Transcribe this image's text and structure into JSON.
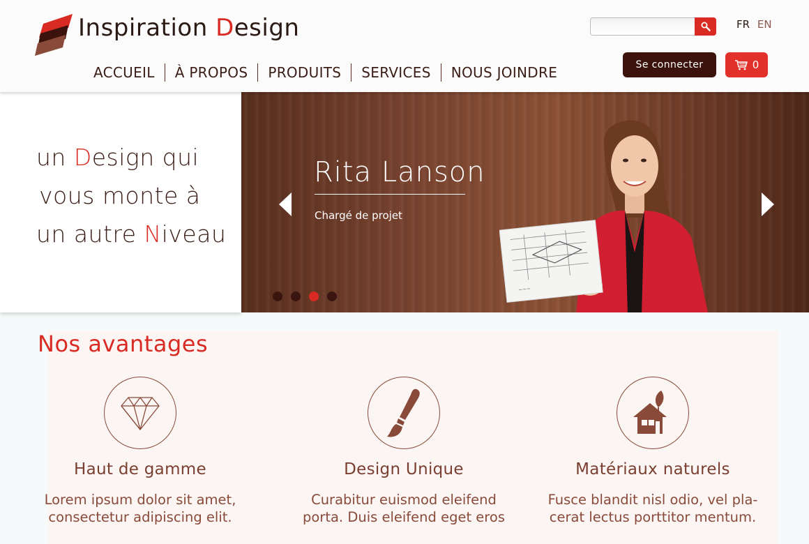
{
  "header": {
    "logo_text_main": "Inspiration ",
    "logo_text_accent": "D",
    "logo_text_rest": "esign",
    "search_placeholder": "",
    "lang_fr": "FR",
    "lang_en": "EN",
    "login_label": "Se connecter",
    "cart_count": "0",
    "nav": [
      "ACCUEIL",
      "À PROPOS",
      "PRODUITS",
      "SERVICES",
      "NOUS JOINDRE"
    ]
  },
  "hero": {
    "tagline": {
      "line1_pre": "un ",
      "line1_accent": "D",
      "line1_post": "esign qui",
      "line2": "vous monte à",
      "line3_pre": "un autre ",
      "line3_accent": "N",
      "line3_post": "iveau"
    },
    "slide": {
      "name": "Rita Lanson",
      "role": "Chargé de projet",
      "active_index": 3,
      "total": 4
    }
  },
  "advantages": {
    "title": "Nos avantages",
    "items": [
      {
        "icon": "diamond-icon",
        "title": "Haut de gamme",
        "text_line1": "Lorem ipsum dolor sit amet,",
        "text_line2": "consectetur adipiscing elit."
      },
      {
        "icon": "paintbrush-icon",
        "title": "Design Unique",
        "text_line1": "Curabitur euismod eleifend",
        "text_line2": "porta. Duis eleifend eget eros"
      },
      {
        "icon": "eco-house-icon",
        "title": "Matériaux naturels",
        "text_line1": "Fusce blandit nisl odio, vel pla-",
        "text_line2": "cerat lectus porttitor mentum."
      }
    ]
  },
  "colors": {
    "accent": "#d92b23",
    "dark_brown": "#3b130c",
    "brown_text": "#7a3f31"
  }
}
